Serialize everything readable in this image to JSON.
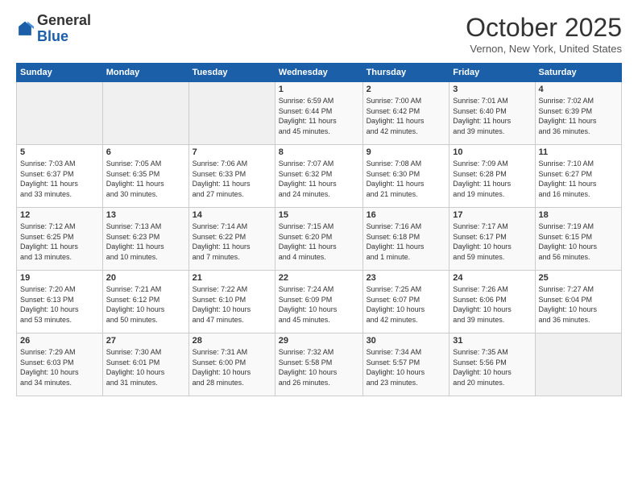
{
  "header": {
    "logo_general": "General",
    "logo_blue": "Blue",
    "month": "October 2025",
    "location": "Vernon, New York, United States"
  },
  "weekdays": [
    "Sunday",
    "Monday",
    "Tuesday",
    "Wednesday",
    "Thursday",
    "Friday",
    "Saturday"
  ],
  "weeks": [
    [
      {
        "day": "",
        "info": ""
      },
      {
        "day": "",
        "info": ""
      },
      {
        "day": "",
        "info": ""
      },
      {
        "day": "1",
        "info": "Sunrise: 6:59 AM\nSunset: 6:44 PM\nDaylight: 11 hours\nand 45 minutes."
      },
      {
        "day": "2",
        "info": "Sunrise: 7:00 AM\nSunset: 6:42 PM\nDaylight: 11 hours\nand 42 minutes."
      },
      {
        "day": "3",
        "info": "Sunrise: 7:01 AM\nSunset: 6:40 PM\nDaylight: 11 hours\nand 39 minutes."
      },
      {
        "day": "4",
        "info": "Sunrise: 7:02 AM\nSunset: 6:39 PM\nDaylight: 11 hours\nand 36 minutes."
      }
    ],
    [
      {
        "day": "5",
        "info": "Sunrise: 7:03 AM\nSunset: 6:37 PM\nDaylight: 11 hours\nand 33 minutes."
      },
      {
        "day": "6",
        "info": "Sunrise: 7:05 AM\nSunset: 6:35 PM\nDaylight: 11 hours\nand 30 minutes."
      },
      {
        "day": "7",
        "info": "Sunrise: 7:06 AM\nSunset: 6:33 PM\nDaylight: 11 hours\nand 27 minutes."
      },
      {
        "day": "8",
        "info": "Sunrise: 7:07 AM\nSunset: 6:32 PM\nDaylight: 11 hours\nand 24 minutes."
      },
      {
        "day": "9",
        "info": "Sunrise: 7:08 AM\nSunset: 6:30 PM\nDaylight: 11 hours\nand 21 minutes."
      },
      {
        "day": "10",
        "info": "Sunrise: 7:09 AM\nSunset: 6:28 PM\nDaylight: 11 hours\nand 19 minutes."
      },
      {
        "day": "11",
        "info": "Sunrise: 7:10 AM\nSunset: 6:27 PM\nDaylight: 11 hours\nand 16 minutes."
      }
    ],
    [
      {
        "day": "12",
        "info": "Sunrise: 7:12 AM\nSunset: 6:25 PM\nDaylight: 11 hours\nand 13 minutes."
      },
      {
        "day": "13",
        "info": "Sunrise: 7:13 AM\nSunset: 6:23 PM\nDaylight: 11 hours\nand 10 minutes."
      },
      {
        "day": "14",
        "info": "Sunrise: 7:14 AM\nSunset: 6:22 PM\nDaylight: 11 hours\nand 7 minutes."
      },
      {
        "day": "15",
        "info": "Sunrise: 7:15 AM\nSunset: 6:20 PM\nDaylight: 11 hours\nand 4 minutes."
      },
      {
        "day": "16",
        "info": "Sunrise: 7:16 AM\nSunset: 6:18 PM\nDaylight: 11 hours\nand 1 minute."
      },
      {
        "day": "17",
        "info": "Sunrise: 7:17 AM\nSunset: 6:17 PM\nDaylight: 10 hours\nand 59 minutes."
      },
      {
        "day": "18",
        "info": "Sunrise: 7:19 AM\nSunset: 6:15 PM\nDaylight: 10 hours\nand 56 minutes."
      }
    ],
    [
      {
        "day": "19",
        "info": "Sunrise: 7:20 AM\nSunset: 6:13 PM\nDaylight: 10 hours\nand 53 minutes."
      },
      {
        "day": "20",
        "info": "Sunrise: 7:21 AM\nSunset: 6:12 PM\nDaylight: 10 hours\nand 50 minutes."
      },
      {
        "day": "21",
        "info": "Sunrise: 7:22 AM\nSunset: 6:10 PM\nDaylight: 10 hours\nand 47 minutes."
      },
      {
        "day": "22",
        "info": "Sunrise: 7:24 AM\nSunset: 6:09 PM\nDaylight: 10 hours\nand 45 minutes."
      },
      {
        "day": "23",
        "info": "Sunrise: 7:25 AM\nSunset: 6:07 PM\nDaylight: 10 hours\nand 42 minutes."
      },
      {
        "day": "24",
        "info": "Sunrise: 7:26 AM\nSunset: 6:06 PM\nDaylight: 10 hours\nand 39 minutes."
      },
      {
        "day": "25",
        "info": "Sunrise: 7:27 AM\nSunset: 6:04 PM\nDaylight: 10 hours\nand 36 minutes."
      }
    ],
    [
      {
        "day": "26",
        "info": "Sunrise: 7:29 AM\nSunset: 6:03 PM\nDaylight: 10 hours\nand 34 minutes."
      },
      {
        "day": "27",
        "info": "Sunrise: 7:30 AM\nSunset: 6:01 PM\nDaylight: 10 hours\nand 31 minutes."
      },
      {
        "day": "28",
        "info": "Sunrise: 7:31 AM\nSunset: 6:00 PM\nDaylight: 10 hours\nand 28 minutes."
      },
      {
        "day": "29",
        "info": "Sunrise: 7:32 AM\nSunset: 5:58 PM\nDaylight: 10 hours\nand 26 minutes."
      },
      {
        "day": "30",
        "info": "Sunrise: 7:34 AM\nSunset: 5:57 PM\nDaylight: 10 hours\nand 23 minutes."
      },
      {
        "day": "31",
        "info": "Sunrise: 7:35 AM\nSunset: 5:56 PM\nDaylight: 10 hours\nand 20 minutes."
      },
      {
        "day": "",
        "info": ""
      }
    ]
  ]
}
